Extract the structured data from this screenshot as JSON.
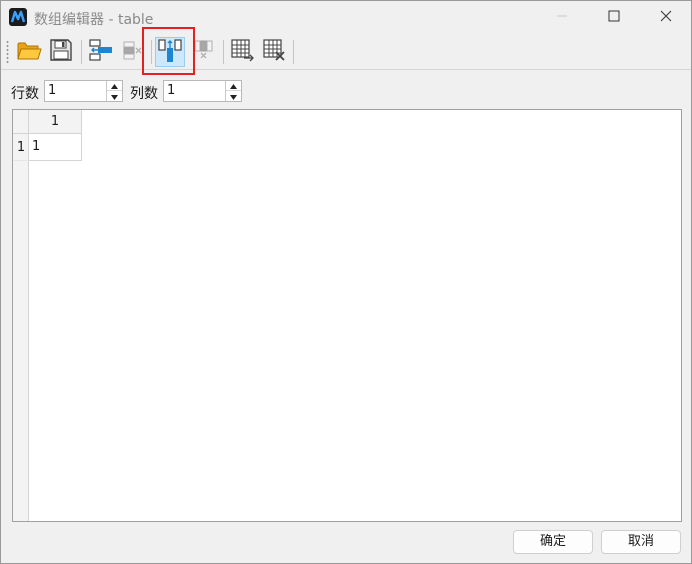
{
  "window": {
    "title": "数组编辑器 - table",
    "icons": {
      "app": "app-logo-icon",
      "minimize": "minimize-icon",
      "maximize": "maximize-icon",
      "close": "close-icon"
    }
  },
  "toolbar": {
    "buttons": [
      {
        "icon": "open-folder-icon",
        "enabled": true
      },
      {
        "icon": "save-icon",
        "enabled": true
      },
      {
        "icon": "insert-row-icon",
        "enabled": true
      },
      {
        "icon": "delete-row-icon",
        "enabled": false
      },
      {
        "icon": "insert-column-icon",
        "enabled": true,
        "active": true
      },
      {
        "icon": "delete-column-icon",
        "enabled": false
      },
      {
        "icon": "table-import-icon",
        "enabled": true
      },
      {
        "icon": "table-clear-icon",
        "enabled": true
      }
    ]
  },
  "controls": {
    "rows_label": "行数",
    "rows_value": "1",
    "cols_label": "列数",
    "cols_value": "1"
  },
  "grid": {
    "column_headers": [
      "1"
    ],
    "rows": [
      {
        "header": "1",
        "cells": [
          "1"
        ]
      }
    ]
  },
  "footer": {
    "ok_label": "确定",
    "cancel_label": "取消"
  },
  "colors": {
    "accent": "#1d86d1",
    "highlight_box": "#e52020",
    "active_button_bg": "#cde8fb"
  }
}
